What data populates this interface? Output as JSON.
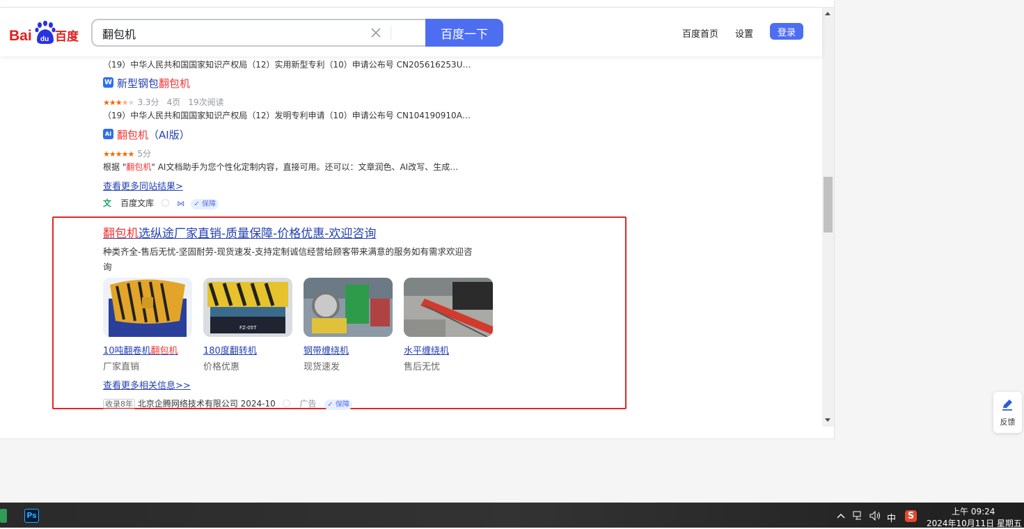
{
  "header": {
    "logo_text_left": "Bai",
    "logo_text_du": "du",
    "logo_text_right": "百度",
    "search_value": "翻包机",
    "search_button": "百度一下",
    "links": [
      "百度首页",
      "设置"
    ],
    "login": "登录"
  },
  "results": {
    "r0_snippet": "（19）中华人民共和国国家知识产权局（12）实用新型专利（10）申请公布号 CN205616253U…",
    "r1": {
      "icon": "W",
      "title_pre": "新型钢包",
      "title_hl": "翻包机",
      "rating": "3.3分",
      "pages": "4页",
      "reads": "19次阅读",
      "snippet": "（19）中华人民共和国国家知识产权局（12）发明专利申请（10）申请公布号 CN104190910A…"
    },
    "r2": {
      "icon": "AI",
      "title_hl": "翻包机",
      "title_post": "（AI版）",
      "rating": "5分",
      "snippet_pre": "根据 \"",
      "snippet_hl": "翻包机",
      "snippet_post": "\" AI文档助手为您个性化定制内容，直接可用。还可以：文章润色、AI改写、生成…"
    },
    "more_same_site": "查看更多同站结果>",
    "source": "百度文库",
    "badge": "保障"
  },
  "ad": {
    "title_hl": "翻包机",
    "title_post": "选纵途厂家直销-质量保障-价格优惠-欢迎咨询",
    "desc_line1": "种类齐全-售后无忧-坚固耐劳-现货速发-支持定制诚信经营给顾客带来满意的服务如有需求欢迎咨",
    "desc_line2": "询",
    "items": [
      {
        "label_pre": "10吨翻卷机",
        "label_hl": "翻包机",
        "sub": "厂家直销"
      },
      {
        "label_pre": "180度翻转机",
        "label_hl": "",
        "sub": "价格优惠"
      },
      {
        "label_pre": "钢带缠绕机",
        "label_hl": "",
        "sub": "现货速发"
      },
      {
        "label_pre": "水平缠绕机",
        "label_hl": "",
        "sub": "售后无忧"
      }
    ],
    "thumb2_text": "FZ-05T",
    "more": "查看更多相关信息>>",
    "years": "收录8年",
    "company": "北京企腾网络技术有限公司 2024-10",
    "ad_label": "广告",
    "badge": "保障"
  },
  "feedback": "反馈",
  "taskbar": {
    "ps_label": "Ps",
    "ime": "中",
    "time": "上午 09:24",
    "date": "2024年10月11日 星期五"
  },
  "colors": {
    "brand_blue": "#4e6ef2",
    "link_blue": "#2440b3",
    "highlight_red": "#f73131",
    "frame_red": "#e52323"
  }
}
